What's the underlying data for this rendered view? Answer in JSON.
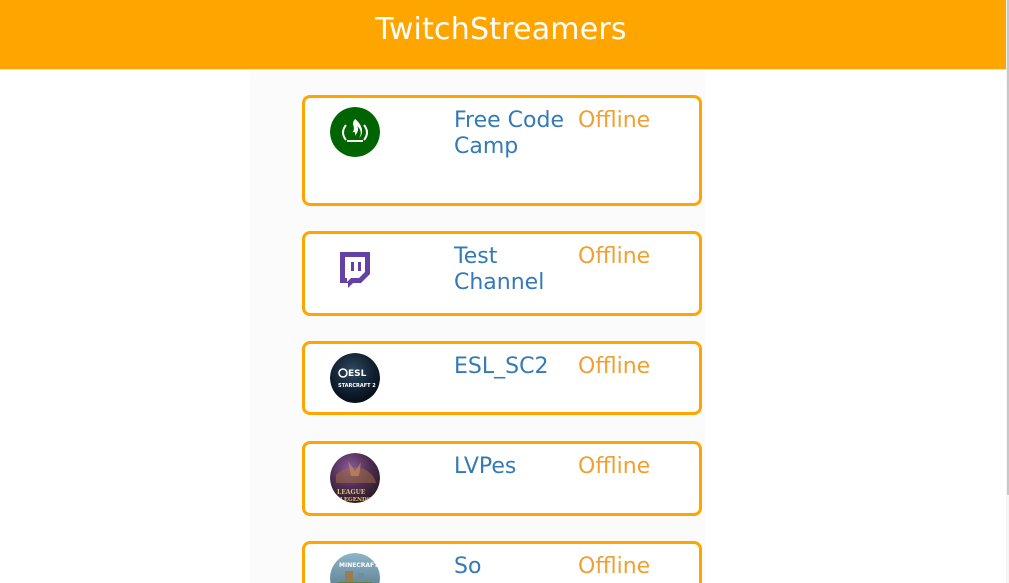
{
  "app": {
    "title": "TwitchStreamers"
  },
  "theme": {
    "accent": "#ffa500",
    "link": "#337ab7",
    "status": "#f0a030"
  },
  "streamers": [
    {
      "name": "Free Code Camp",
      "status": "Offline",
      "logo_icon": "free-code-camp-logo-icon"
    },
    {
      "name": "Test Channel",
      "status": "Offline",
      "logo_icon": "twitch-logo-icon"
    },
    {
      "name": "ESL_SC2",
      "status": "Offline",
      "logo_icon": "esl-starcraft-logo-icon",
      "logo_text": [
        "ESL",
        "STARCRAFT 2"
      ]
    },
    {
      "name": "LVPes",
      "status": "Offline",
      "logo_icon": "league-of-legends-logo-icon",
      "logo_text": [
        "LEAGUE",
        "LEGENDS"
      ]
    },
    {
      "name": "So",
      "status": "Offline",
      "logo_icon": "minecraft-logo-icon",
      "logo_text": [
        "MINECRAFT"
      ]
    }
  ]
}
